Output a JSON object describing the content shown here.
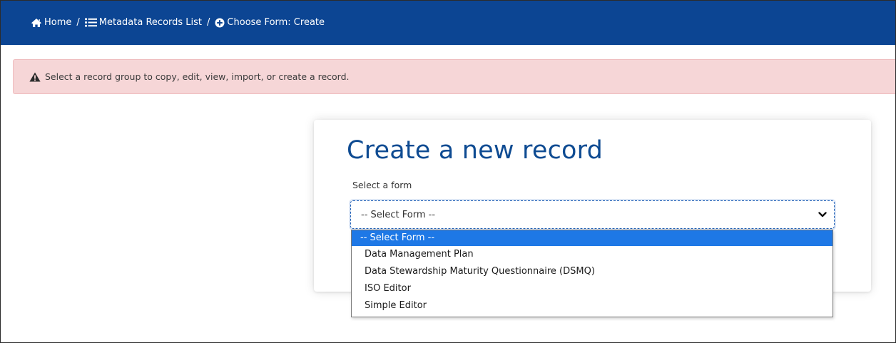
{
  "breadcrumb": {
    "items": [
      {
        "label": "Home",
        "icon": "home-icon"
      },
      {
        "label": "Metadata Records List",
        "icon": "list-icon"
      },
      {
        "label": "Choose Form: Create",
        "icon": "plus-circle-icon"
      }
    ],
    "separator": "/"
  },
  "alert": {
    "icon": "warning-icon",
    "message": "Select a record group to copy, edit, view, import, or create a record."
  },
  "form": {
    "title": "Create a new record",
    "select_label": "Select a form",
    "selected_value": "-- Select Form --",
    "options": [
      "-- Select Form --",
      "Data Management Plan",
      "Data Stewardship Maturity Questionnaire (DSMQ)",
      "ISO Editor",
      "Simple Editor"
    ]
  },
  "colors": {
    "topbar": "#0c4593",
    "title": "#0e4b92",
    "alert_bg": "#f6d6d7",
    "option_highlight": "#1e78e6"
  }
}
